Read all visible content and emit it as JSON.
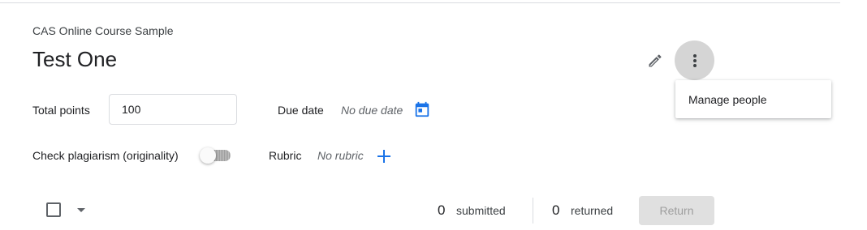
{
  "header": {
    "course_name": "CAS Online Course Sample",
    "assignment_title": "Test One"
  },
  "actions": {
    "edit_icon": "pencil-icon",
    "more_icon": "more-vert-icon"
  },
  "menu": {
    "items": [
      {
        "label": "Manage people"
      }
    ]
  },
  "settings": {
    "total_points_label": "Total points",
    "total_points_value": "100",
    "due_date_label": "Due date",
    "due_date_value": "No due date",
    "plagiarism_label": "Check plagiarism (originality)",
    "plagiarism_enabled": false,
    "rubric_label": "Rubric",
    "rubric_value": "No rubric"
  },
  "stats": {
    "submitted_count": "0",
    "submitted_label": "submitted",
    "returned_count": "0",
    "returned_label": "returned",
    "return_button": "Return"
  },
  "colors": {
    "accent": "#1a73e8",
    "more_button_bg": "#d5d5d5",
    "return_button_bg": "#e0e0e0"
  }
}
